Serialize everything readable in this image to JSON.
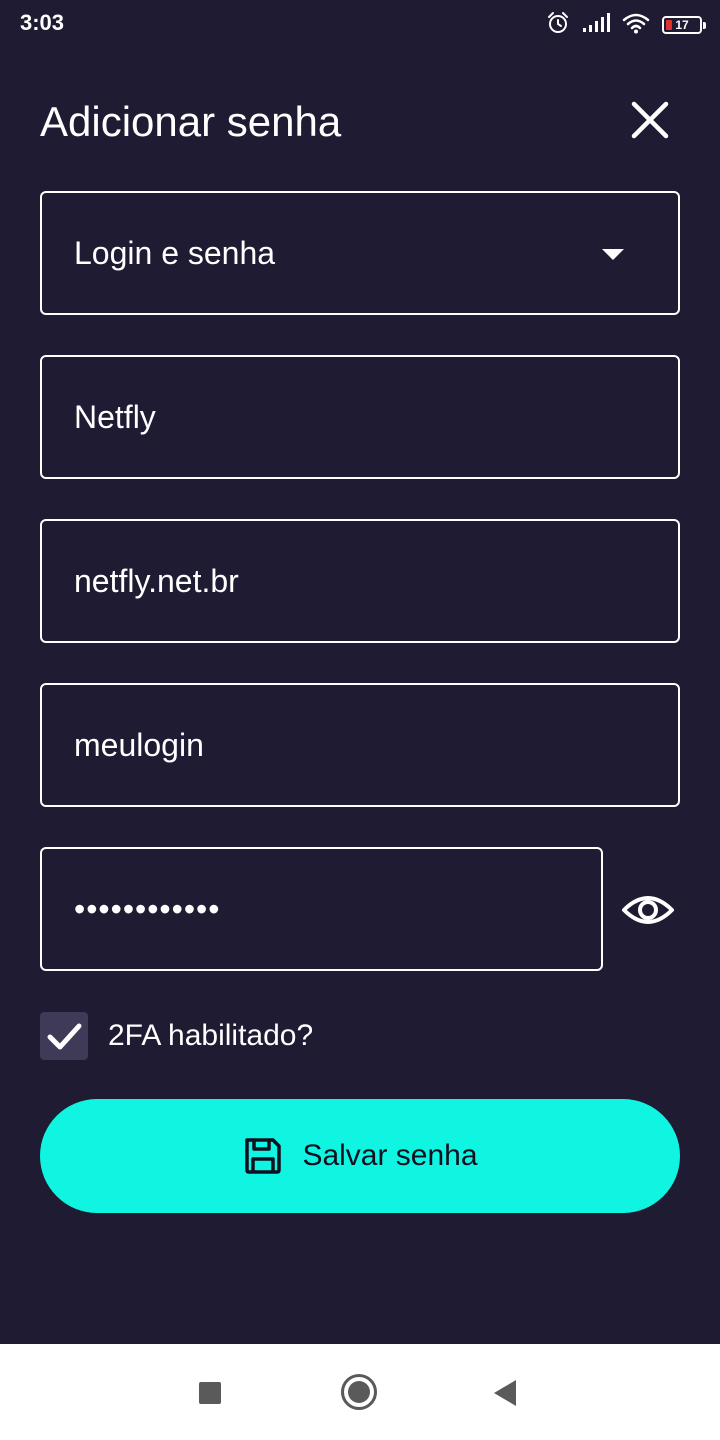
{
  "status_bar": {
    "time": "3:03",
    "battery_level": "17",
    "icons": [
      "alarm-icon",
      "signal-icon",
      "wifi-icon",
      "battery-icon"
    ]
  },
  "header": {
    "title": "Adicionar senha",
    "close_icon": "close-icon"
  },
  "form": {
    "type_select": {
      "value": "Login e senha",
      "icon": "dropdown-arrow-icon"
    },
    "name_field": {
      "value": "Netfly"
    },
    "url_field": {
      "value": "netfly.net.br"
    },
    "login_field": {
      "value": "meulogin"
    },
    "password_field": {
      "value": "••••••••••••",
      "toggle_icon": "eye-icon"
    },
    "twofa_checkbox": {
      "label": "2FA habilitado?",
      "checked": true
    },
    "save_button": {
      "label": "Salvar senha",
      "icon": "save-icon"
    }
  },
  "nav_bar": {
    "icons": [
      "recent-apps-icon",
      "home-icon",
      "back-icon"
    ]
  },
  "colors": {
    "background": "#1f1b32",
    "accent": "#0ff5e1",
    "checkbox_bg": "#3e3a58",
    "battery_low": "#e03131"
  }
}
